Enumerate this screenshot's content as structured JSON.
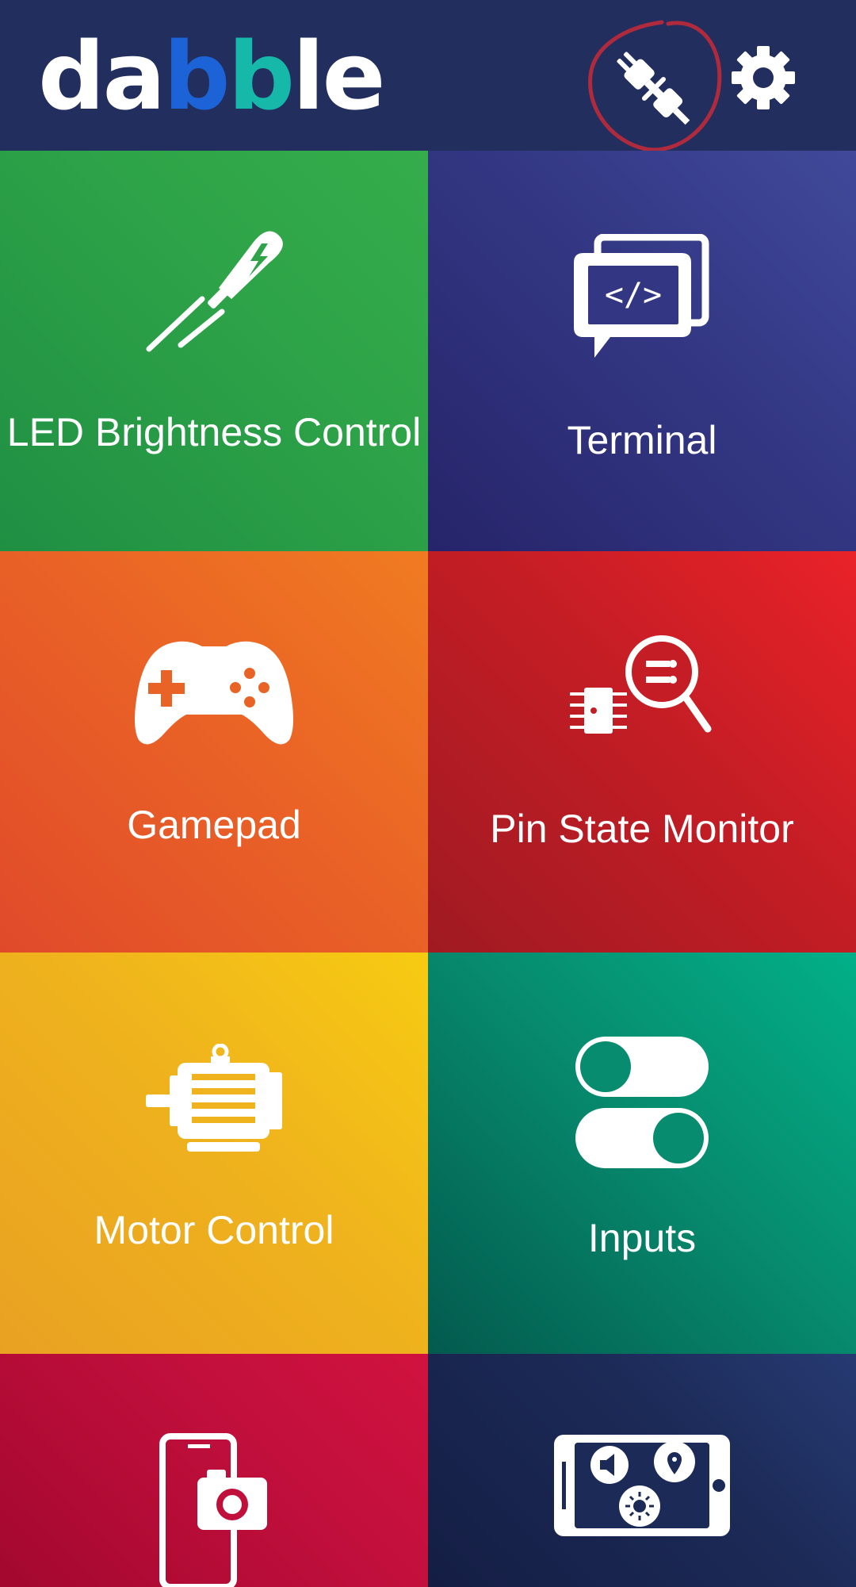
{
  "app": {
    "logo": {
      "text": "dabble",
      "part1": "da",
      "part2": "b",
      "part3": "b",
      "part4": "le"
    },
    "colors": {
      "appbar": "#222f5e",
      "logo_blue": "#1b63d6",
      "logo_teal": "#16b8a9",
      "annotation": "#b02a3d"
    },
    "actions": {
      "connect_icon": "plug-connect-icon",
      "settings_icon": "gear-icon"
    }
  },
  "tiles": [
    {
      "label": "LED Brightness Control",
      "icon": "led-icon",
      "color": "#2ea348"
    },
    {
      "label": "Terminal",
      "icon": "terminal-icon",
      "color": "#333783"
    },
    {
      "label": "Gamepad",
      "icon": "gamepad-icon",
      "color": "#ea6326"
    },
    {
      "label": "Pin State Monitor",
      "icon": "pin-monitor-icon",
      "color": "#c41d25"
    },
    {
      "label": "Motor Control",
      "icon": "motor-icon",
      "color": "#efb31d"
    },
    {
      "label": "Inputs",
      "icon": "toggle-switches-icon",
      "color": "#078c6f"
    },
    {
      "label": "",
      "icon": "phone-camera-icon",
      "color": "#c10f3c"
    },
    {
      "label": "",
      "icon": "phone-sensor-icon",
      "color": "#1c2a57"
    }
  ]
}
